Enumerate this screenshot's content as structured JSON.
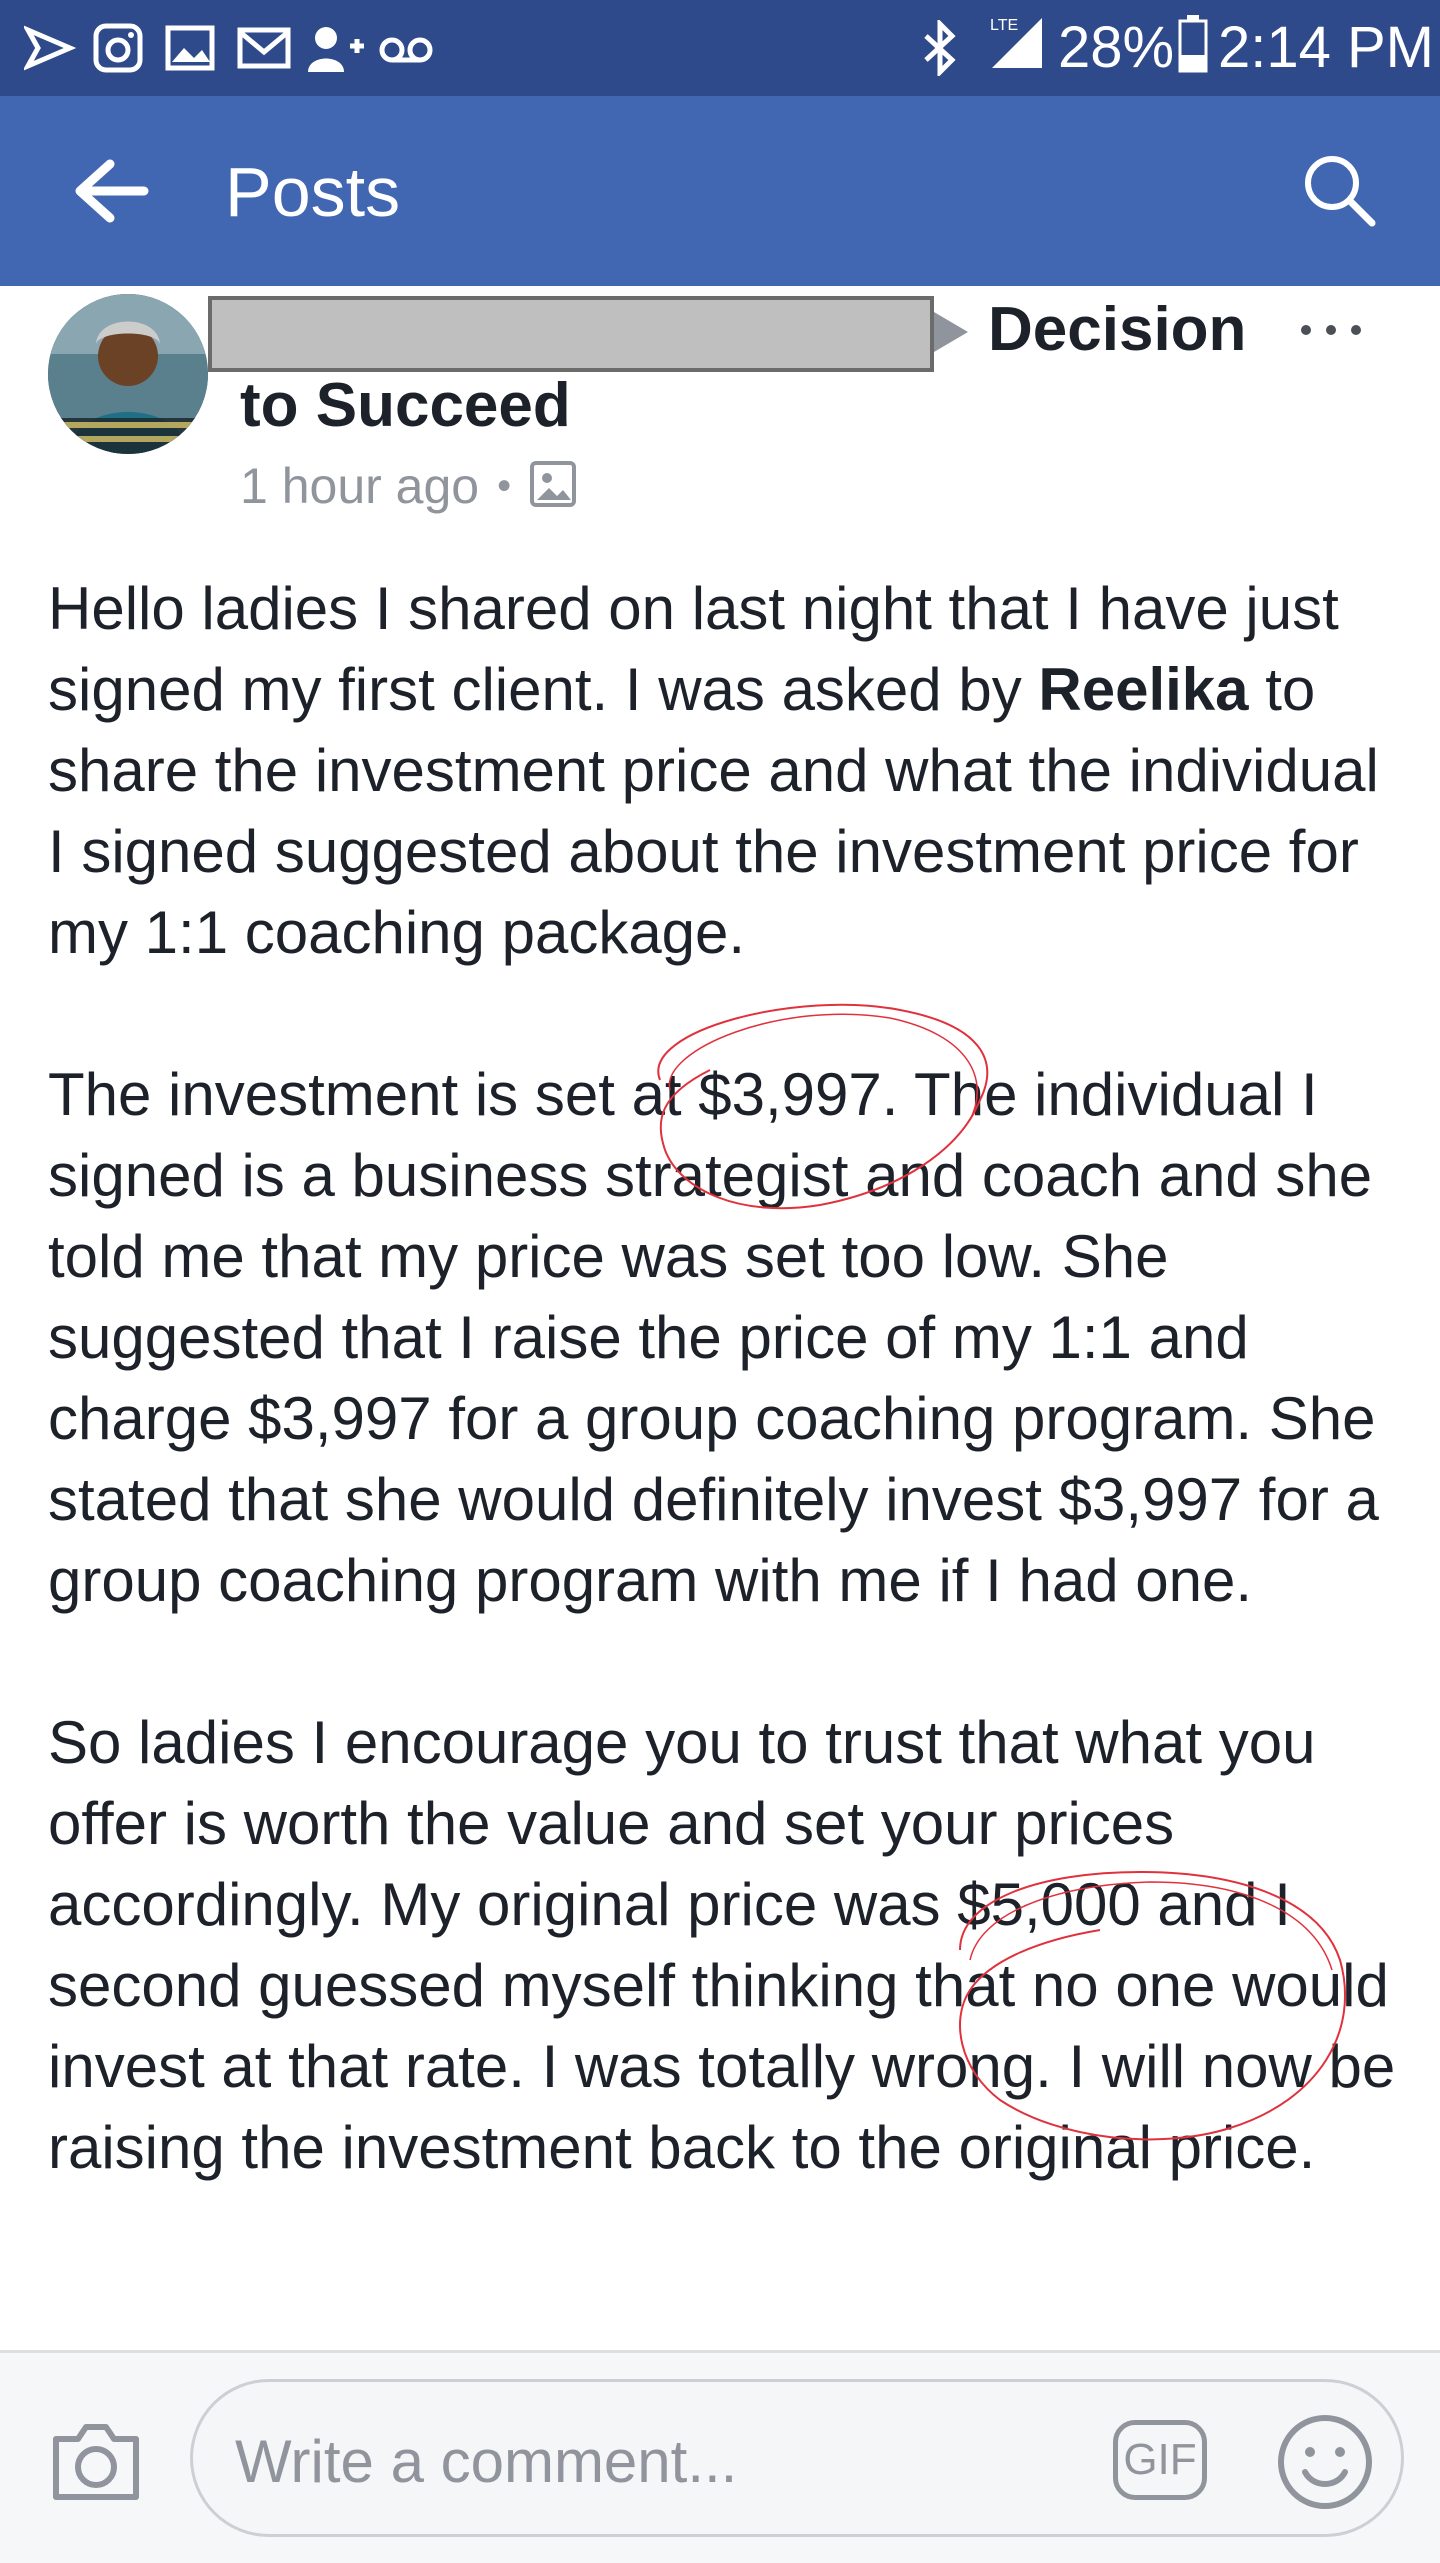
{
  "status_bar": {
    "battery": "28%",
    "time": "2:14 PM",
    "network": "LTE"
  },
  "app_bar": {
    "title": "Posts"
  },
  "post": {
    "group_name_part1": "Decision",
    "group_name_part2": "to Succeed",
    "timestamp": "1 hour ago",
    "paragraph1_before": "Hello ladies I shared on last night that I have just signed my first client. I was asked by ",
    "mention": "Reelika",
    "paragraph1_after": " to share the investment price and what the individual I signed suggested about the investment price for my 1:1 coaching package.",
    "paragraph2": "The investment is set at $3,997. The individual I signed is a business strategist and coach and she told me that my price was set too low. She suggested that I raise the price of my 1:1 and charge $3,997 for a group coaching program. She stated that she would definitely invest $3,997 for a group coaching program with me if I had one.",
    "paragraph3": "So ladies I encourage you to trust that what you offer is worth the value and set your prices accordingly. My original price was $5,000 and I second guessed myself thinking that no one would invest at that rate. I was totally wrong. I will now be raising the investment back to the original price."
  },
  "comment_bar": {
    "placeholder": "Write a comment...",
    "gif_label": "GIF"
  },
  "colors": {
    "status_bar": "#2f4a8a",
    "app_bar": "#4267b2",
    "annotation": "#e0323c"
  },
  "icons": [
    "back-arrow-icon",
    "search-icon",
    "more-options-icon",
    "photo-icon",
    "camera-icon",
    "emoji-icon"
  ]
}
